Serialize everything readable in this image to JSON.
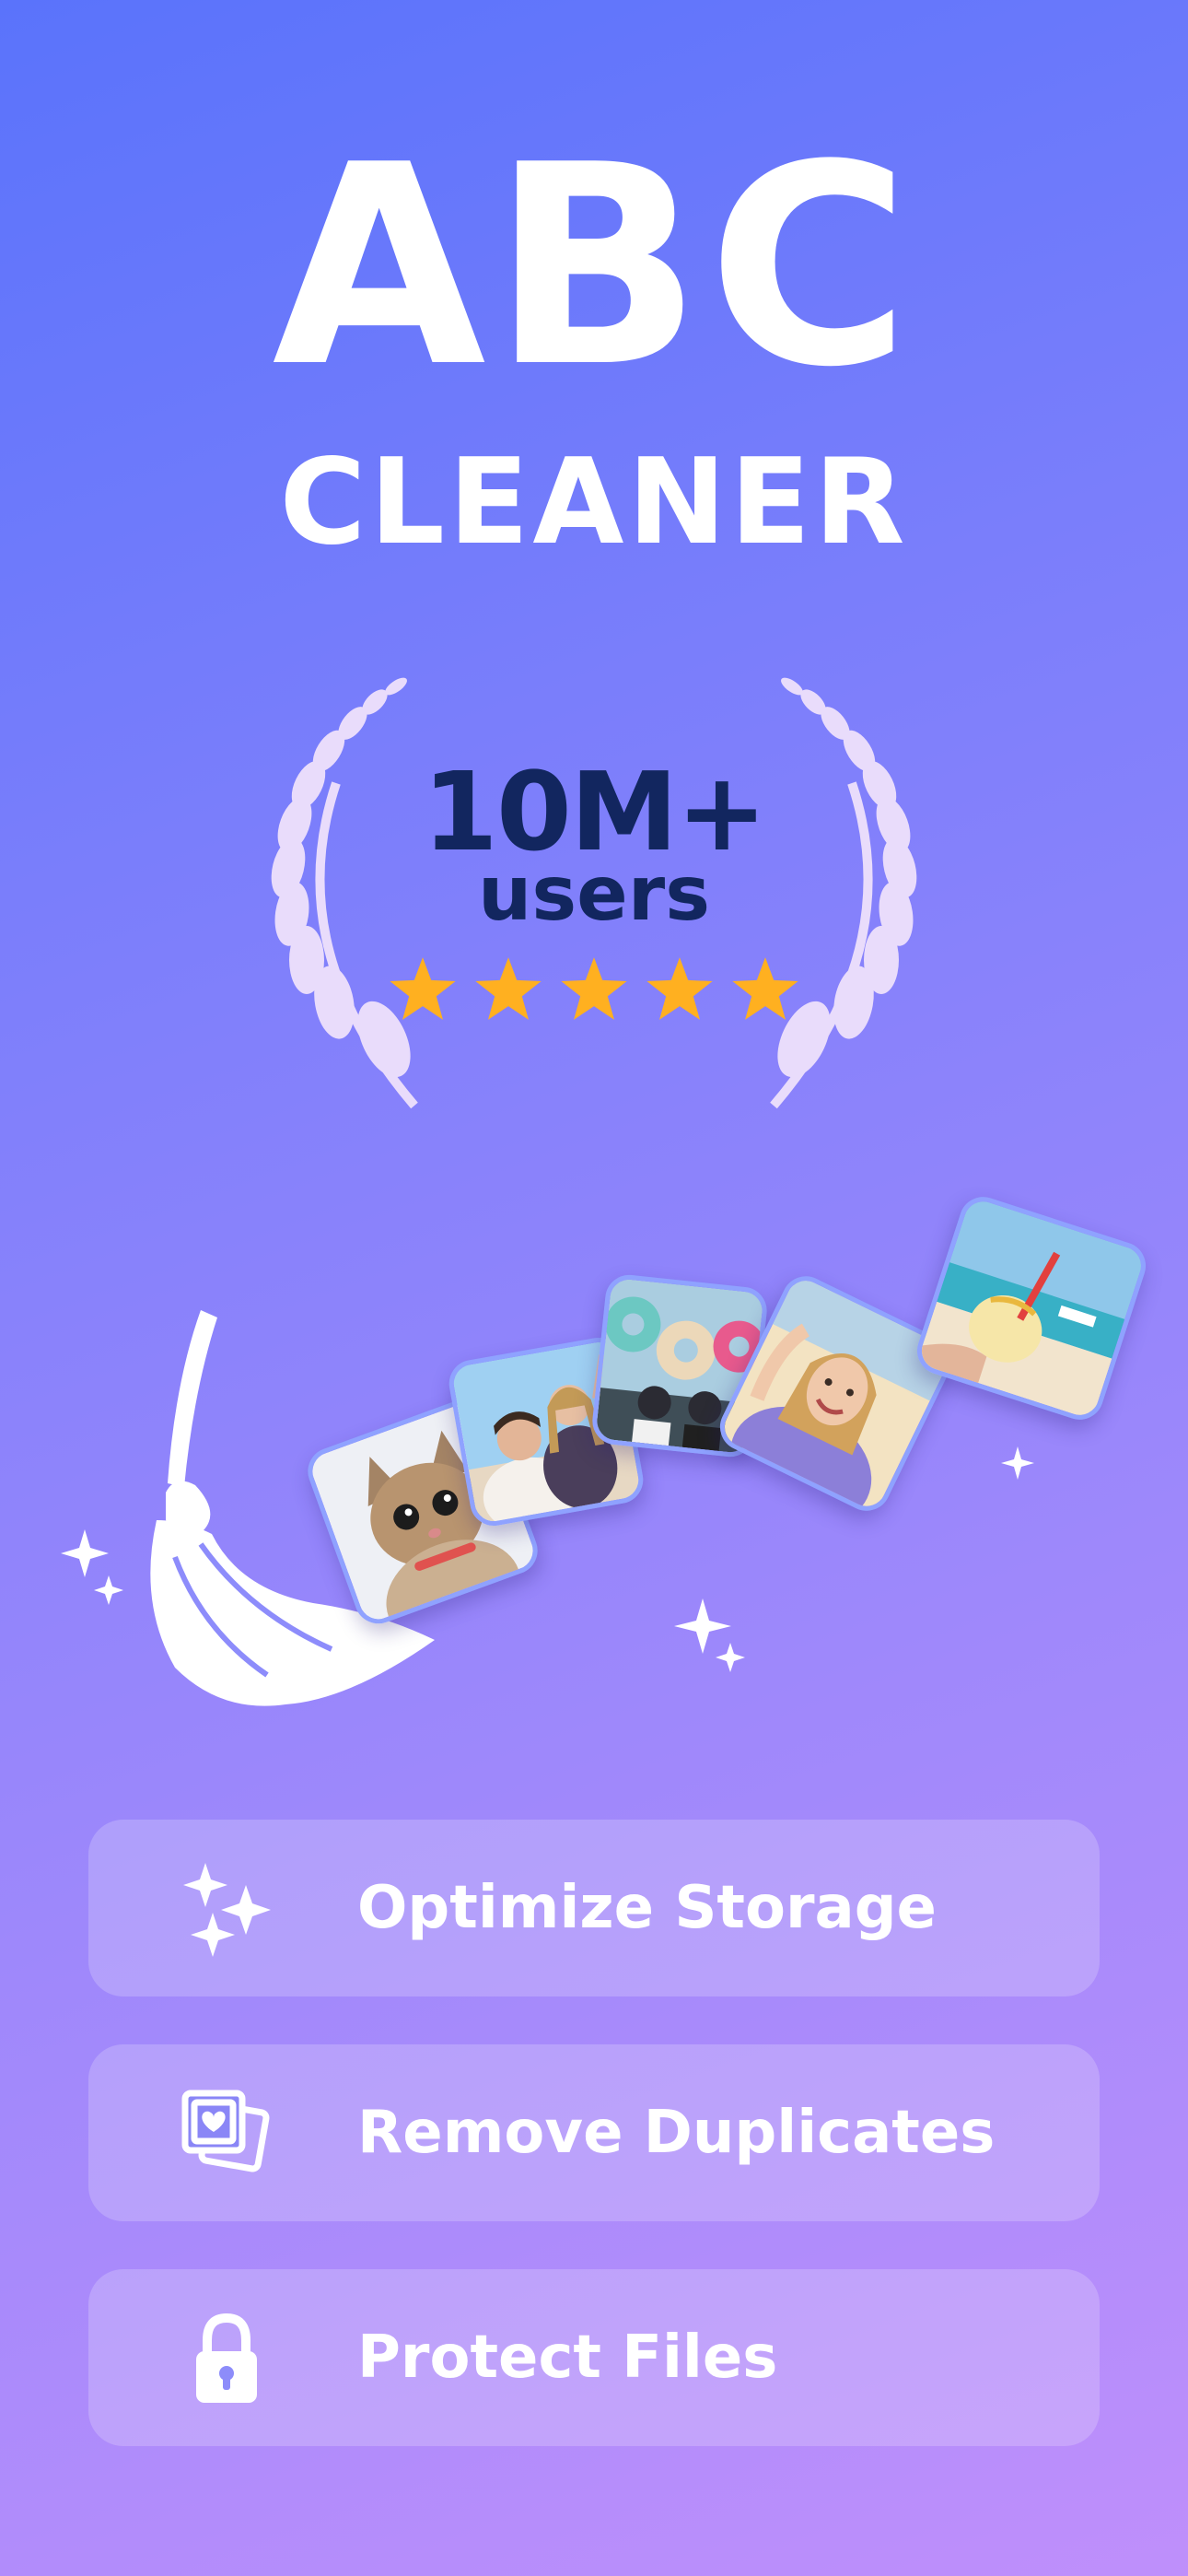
{
  "header": {
    "title": "ABC",
    "subtitle": "CLEANER"
  },
  "award": {
    "count": "10M+",
    "label": "users",
    "rating": 5,
    "star_color": "#ffb020",
    "text_color": "#12265f"
  },
  "illustration": {
    "icons": [
      "broom-icon",
      "sparkle-icon"
    ],
    "photos": [
      "cat-photo",
      "couple-selfie-photo",
      "donuts-photo",
      "woman-selfie-photo",
      "beach-drink-photo"
    ]
  },
  "features": [
    {
      "icon": "sparkles-icon",
      "label": "Optimize Storage"
    },
    {
      "icon": "photos-icon",
      "label": "Remove Duplicates"
    },
    {
      "icon": "lock-icon",
      "label": "Protect Files"
    }
  ],
  "colors": {
    "background_start": "#5a73fb",
    "background_end": "#bf8ffb",
    "photo_border": "#8fa2ff",
    "wreath": "#e9dcfb"
  }
}
